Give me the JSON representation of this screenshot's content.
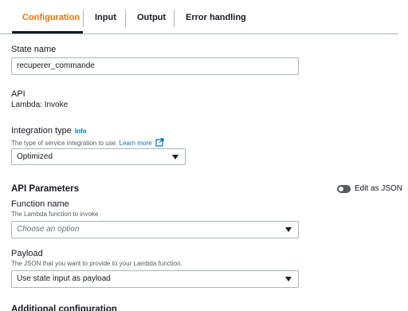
{
  "tabs": [
    {
      "label": "Configuration",
      "active": true
    },
    {
      "label": "Input",
      "active": false
    },
    {
      "label": "Output",
      "active": false
    },
    {
      "label": "Error handling",
      "active": false
    }
  ],
  "state_name": {
    "label": "State name",
    "value": "recuperer_commande"
  },
  "api": {
    "label": "API",
    "value": "Lambda: Invoke"
  },
  "integration_type": {
    "label": "Integration type",
    "info_label": "Info",
    "description": "The type of service integration to use.",
    "learn_more_label": "Learn more",
    "selected": "Optimized"
  },
  "api_parameters": {
    "title": "API Parameters",
    "edit_json_label": "Edit as JSON",
    "edit_json_enabled": false
  },
  "function_name": {
    "label": "Function name",
    "description": "The Lambda function to invoke",
    "placeholder": "Choose an option"
  },
  "payload": {
    "label": "Payload",
    "description": "The JSON that you want to provide to your Lambda function.",
    "selected": "Use state input as payload"
  },
  "additional_config": {
    "title": "Additional configuration"
  },
  "colors": {
    "accent": "#ec7211",
    "link": "#0073bb",
    "text": "#16191f",
    "border": "#aab7b8"
  }
}
